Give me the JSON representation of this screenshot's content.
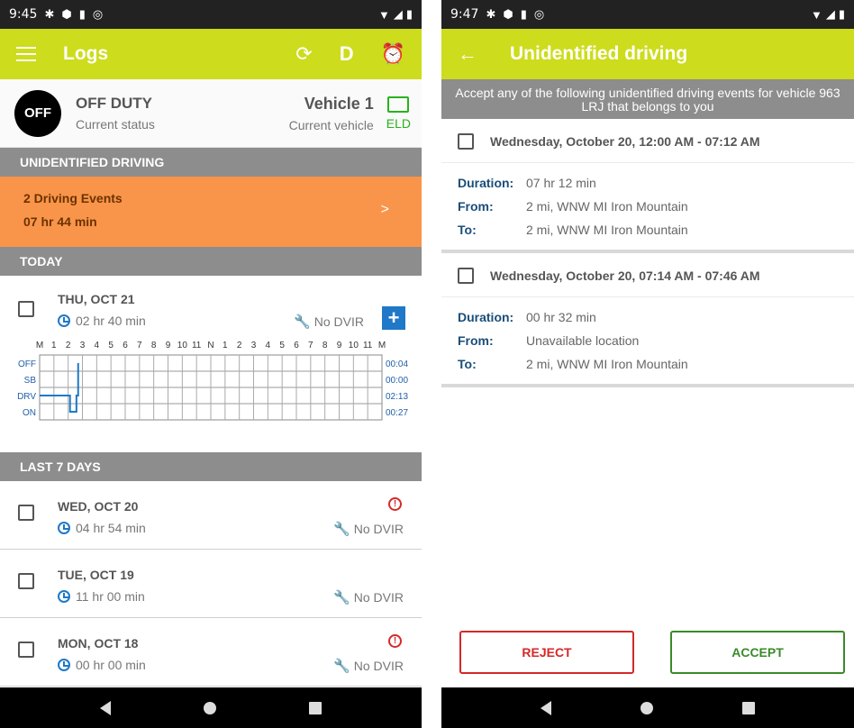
{
  "left": {
    "status_bar": {
      "time": "9:45"
    },
    "app_bar": {
      "title": "Logs",
      "d_label": "D"
    },
    "status": {
      "badge": "OFF",
      "duty": "OFF DUTY",
      "duty_caption": "Current status",
      "vehicle": "Vehicle 1",
      "vehicle_caption": "Current vehicle",
      "eld": "ELD"
    },
    "unidentified": {
      "header": "UNIDENTIFIED DRIVING",
      "events": "2 Driving Events",
      "duration": "07 hr  44 min",
      "chevron": ">"
    },
    "today": {
      "header": "TODAY",
      "day": "THU, OCT 21",
      "time": "02 hr  40 min",
      "dvir": "No DVIR",
      "grid": {
        "hours": [
          "M",
          "1",
          "2",
          "3",
          "4",
          "5",
          "6",
          "7",
          "8",
          "9",
          "10",
          "11",
          "N",
          "1",
          "2",
          "3",
          "4",
          "5",
          "6",
          "7",
          "8",
          "9",
          "10",
          "11",
          "M"
        ],
        "rows": [
          "OFF",
          "SB",
          "DRV",
          "ON"
        ],
        "totals": [
          "00:04",
          "00:00",
          "02:13",
          "00:27"
        ]
      }
    },
    "last7": {
      "header": "LAST 7 DAYS",
      "days": [
        {
          "day": "WED, OCT 20",
          "time": "04 hr  54 min",
          "dvir": "No DVIR",
          "alert": true
        },
        {
          "day": "TUE, OCT 19",
          "time": "11 hr  00 min",
          "dvir": "No DVIR",
          "alert": false
        },
        {
          "day": "MON, OCT 18",
          "time": "00 hr  00 min",
          "dvir": "No DVIR",
          "alert": true
        }
      ]
    }
  },
  "right": {
    "status_bar": {
      "time": "9:47"
    },
    "app_bar": {
      "title": "Unidentified driving"
    },
    "banner": "Accept any of the following unidentified driving events for vehicle 963 LRJ that belongs to you",
    "labels": {
      "duration": "Duration:",
      "from": "From:",
      "to": "To:"
    },
    "events": [
      {
        "title": "Wednesday, October 20, 12:00 AM - 07:12 AM",
        "duration": "07 hr  12 min",
        "from": "2 mi, WNW MI Iron Mountain",
        "to": "2 mi, WNW MI Iron Mountain"
      },
      {
        "title": "Wednesday, October 20, 07:14 AM - 07:46 AM",
        "duration": "00 hr  32 min",
        "from": "Unavailable location",
        "to": "2 mi, WNW MI Iron Mountain"
      }
    ],
    "buttons": {
      "reject": "REJECT",
      "accept": "ACCEPT"
    }
  },
  "colors": {
    "appbar": "#cddc1c",
    "orange": "#f9954a",
    "accent_blue": "#1f78c8",
    "alert_red": "#d62828",
    "accept_green": "#3a8a2a",
    "eld_green": "#28b21c"
  }
}
